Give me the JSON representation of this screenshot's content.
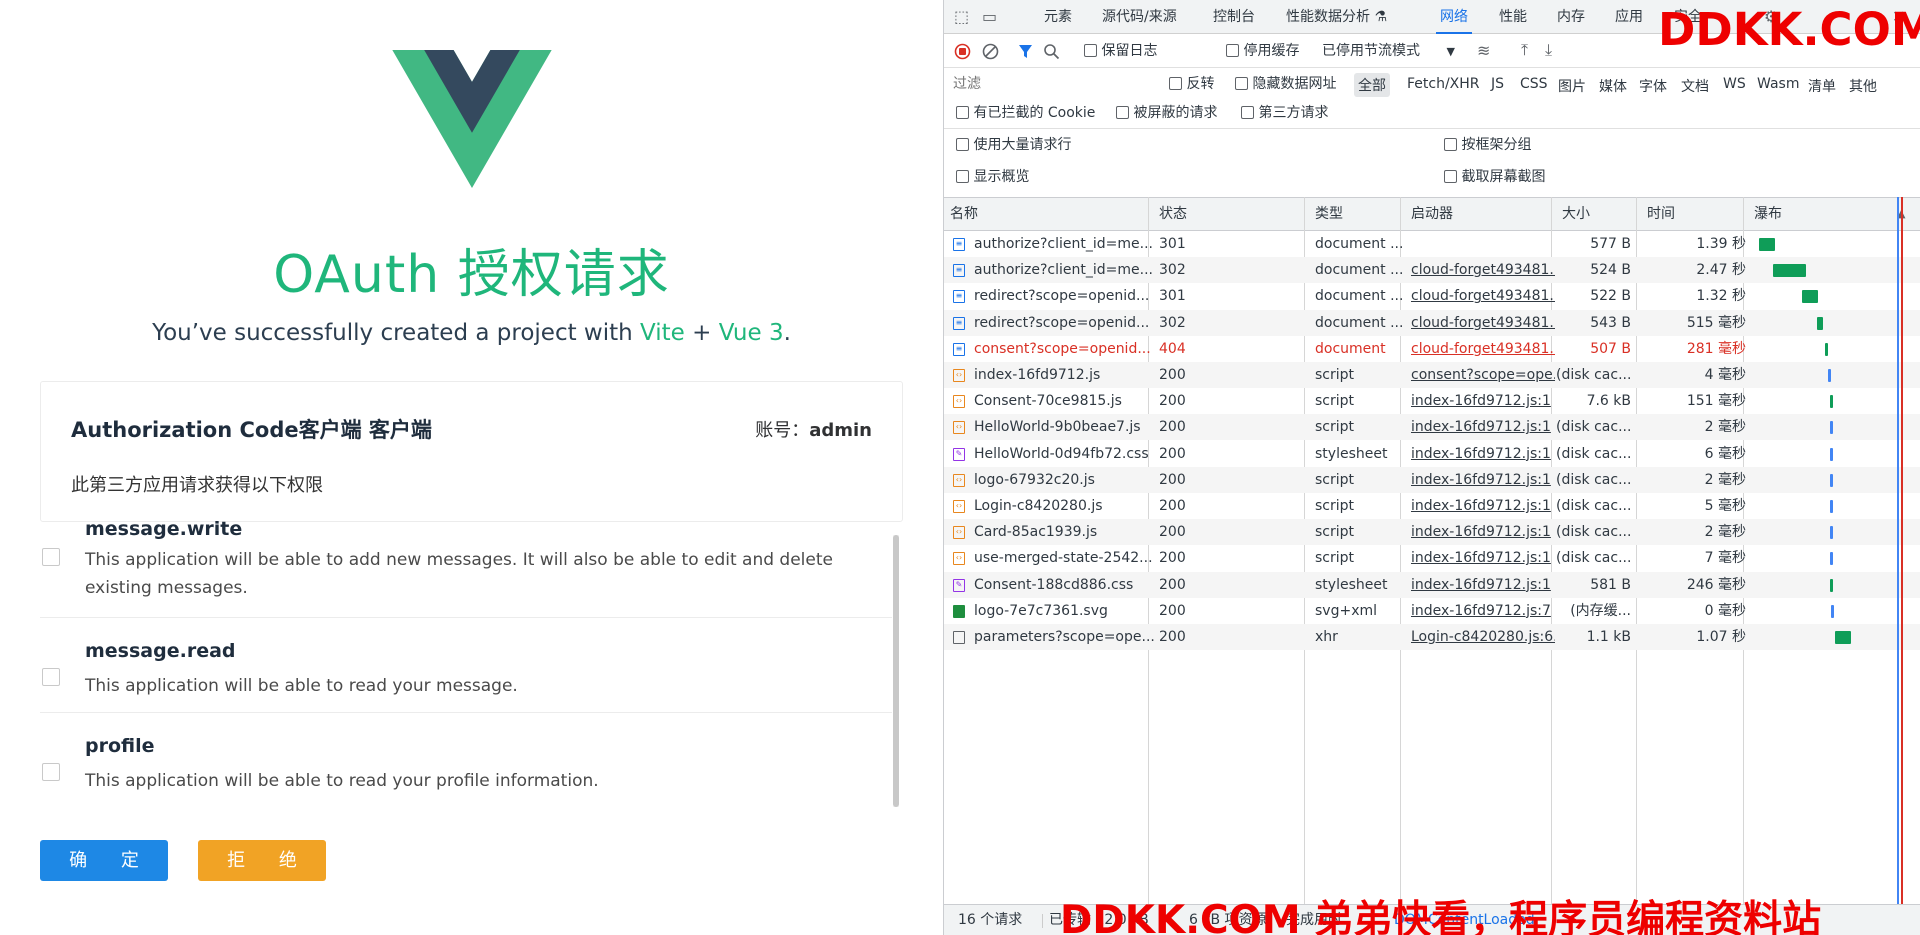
{
  "page": {
    "title": "OAuth 授权请求",
    "subtitle_prefix": "You’ve successfully created a project with ",
    "subtitle_vite": "Vite",
    "subtitle_plus": " + ",
    "subtitle_vue": "Vue 3",
    "subtitle_suffix": "."
  },
  "card": {
    "title": "Authorization Code客户端 客户端",
    "account_label": "账号：",
    "account_value": "admin",
    "description": "此第三方应用请求获得以下权限"
  },
  "scopes": [
    {
      "name": "message.write",
      "description": "This application will be able to add new messages. It will also be able to edit and delete existing messages.",
      "checked": false
    },
    {
      "name": "message.read",
      "description": "This application will be able to read your message.",
      "checked": false
    },
    {
      "name": "profile",
      "description": "This application will be able to read your profile information.",
      "checked": false
    }
  ],
  "buttons": {
    "confirm": "确 定",
    "reject": "拒 绝"
  },
  "colors": {
    "vue_green": "#41b883",
    "vue_dark": "#34495e",
    "title_green": "#1fb67b",
    "confirm_blue": "#1e88e5",
    "reject_orange": "#f1a325"
  },
  "devtools": {
    "tabs": [
      "元素",
      "源代码/来源",
      "控制台",
      "性能数据分析 ⚗",
      "网络",
      "性能",
      "内存",
      "应用",
      "安全"
    ],
    "active_tab": "网络",
    "toolbar": {
      "preserve_log": "保留日志",
      "disable_cache": "停用缓存",
      "throttling": "已停用节流模式"
    },
    "filter": {
      "placeholder": "过滤",
      "invert": "反转",
      "hide_data_urls": "隐藏数据网址",
      "types": [
        "全部",
        "Fetch/XHR",
        "JS",
        "CSS",
        "图片",
        "媒体",
        "字体",
        "文档",
        "WS",
        "Wasm",
        "清单",
        "其他"
      ],
      "blocked_cookies": "有已拦截的 Cookie",
      "blocked_requests": "被屏蔽的请求",
      "third_party": "第三方请求"
    },
    "options": {
      "big_rows": "使用大量请求行",
      "group_by_frame": "按框架分组",
      "overview": "显示概览",
      "screenshots": "截取屏幕截图"
    },
    "columns": [
      "名称",
      "状态",
      "类型",
      "启动器",
      "大小",
      "时间",
      "瀑布"
    ],
    "requests": [
      {
        "name": "authorize?client_id=me...",
        "status": "301",
        "type": "document ...",
        "initiator": "",
        "size": "577 B",
        "time": "1.39 秒",
        "icon": "document",
        "error": false,
        "wf": [
          0.03,
          0.1,
          "#0f9d58"
        ]
      },
      {
        "name": "authorize?client_id=me...",
        "status": "302",
        "type": "document ...",
        "initiator": "cloud-forget493481...",
        "size": "524 B",
        "time": "2.47 秒",
        "icon": "document",
        "error": false,
        "wf": [
          0.12,
          0.2,
          "#0f9d58"
        ]
      },
      {
        "name": "redirect?scope=openid...",
        "status": "301",
        "type": "document ...",
        "initiator": "cloud-forget493481...",
        "size": "522 B",
        "time": "1.32 秒",
        "icon": "document",
        "error": false,
        "wf": [
          0.3,
          0.1,
          "#0f9d58"
        ]
      },
      {
        "name": "redirect?scope=openid...",
        "status": "302",
        "type": "document ...",
        "initiator": "cloud-forget493481...",
        "size": "543 B",
        "time": "515 毫秒",
        "icon": "document",
        "error": false,
        "wf": [
          0.39,
          0.04,
          "#0f9d58"
        ]
      },
      {
        "name": "consent?scope=openid...",
        "status": "404",
        "type": "document",
        "initiator": "cloud-forget493481...",
        "size": "507 B",
        "time": "281 毫秒",
        "icon": "document",
        "error": true,
        "wf": [
          0.44,
          0.02,
          "#0f9d58"
        ]
      },
      {
        "name": "index-16fd9712.js",
        "status": "200",
        "type": "script",
        "initiator": "consent?scope=ope...",
        "size": "(disk cac...",
        "time": "4 毫秒",
        "icon": "script",
        "error": false,
        "wf": [
          0.46,
          0.01,
          "#4285f4"
        ]
      },
      {
        "name": "Consent-70ce9815.js",
        "status": "200",
        "type": "script",
        "initiator": "index-16fd9712.js:1",
        "size": "7.6 kB",
        "time": "151 毫秒",
        "icon": "script",
        "error": false,
        "wf": [
          0.47,
          0.02,
          "#0f9d58"
        ]
      },
      {
        "name": "HelloWorld-9b0beae7.js",
        "status": "200",
        "type": "script",
        "initiator": "index-16fd9712.js:1",
        "size": "(disk cac...",
        "time": "2 毫秒",
        "icon": "script",
        "error": false,
        "wf": [
          0.47,
          0.01,
          "#4285f4"
        ]
      },
      {
        "name": "HelloWorld-0d94fb72.css",
        "status": "200",
        "type": "stylesheet",
        "initiator": "index-16fd9712.js:1",
        "size": "(disk cac...",
        "time": "6 毫秒",
        "icon": "css",
        "error": false,
        "wf": [
          0.47,
          0.01,
          "#4285f4"
        ]
      },
      {
        "name": "logo-67932c20.js",
        "status": "200",
        "type": "script",
        "initiator": "index-16fd9712.js:1",
        "size": "(disk cac...",
        "time": "2 毫秒",
        "icon": "script",
        "error": false,
        "wf": [
          0.47,
          0.01,
          "#4285f4"
        ]
      },
      {
        "name": "Login-c8420280.js",
        "status": "200",
        "type": "script",
        "initiator": "index-16fd9712.js:1",
        "size": "(disk cac...",
        "time": "5 毫秒",
        "icon": "script",
        "error": false,
        "wf": [
          0.47,
          0.01,
          "#4285f4"
        ]
      },
      {
        "name": "Card-85ac1939.js",
        "status": "200",
        "type": "script",
        "initiator": "index-16fd9712.js:1",
        "size": "(disk cac...",
        "time": "2 毫秒",
        "icon": "script",
        "error": false,
        "wf": [
          0.47,
          0.01,
          "#4285f4"
        ]
      },
      {
        "name": "use-merged-state-2542...",
        "status": "200",
        "type": "script",
        "initiator": "index-16fd9712.js:1",
        "size": "(disk cac...",
        "time": "7 毫秒",
        "icon": "script",
        "error": false,
        "wf": [
          0.47,
          0.01,
          "#4285f4"
        ]
      },
      {
        "name": "Consent-188cd886.css",
        "status": "200",
        "type": "stylesheet",
        "initiator": "index-16fd9712.js:1",
        "size": "581 B",
        "time": "246 毫秒",
        "icon": "css",
        "error": false,
        "wf": [
          0.47,
          0.02,
          "#0f9d58"
        ]
      },
      {
        "name": "logo-7e7c7361.svg",
        "status": "200",
        "type": "svg+xml",
        "initiator": "index-16fd9712.js:7",
        "size": "(内存缓...",
        "time": "0 毫秒",
        "icon": "svg",
        "error": false,
        "wf": [
          0.48,
          0.01,
          "#4285f4"
        ]
      },
      {
        "name": "parameters?scope=ope...",
        "status": "200",
        "type": "xhr",
        "initiator": "Login-c8420280.js:6...",
        "size": "1.1 kB",
        "time": "1.07 秒",
        "icon": "xhr",
        "error": false,
        "wf": [
          0.5,
          0.1,
          "#0f9d58"
        ]
      }
    ],
    "status_bar": {
      "requests": "16 个请求",
      "transferred": "已传输 12.0 kB",
      "resources": "6 kB 项资源",
      "finish": "完成用时",
      "dom_loaded": "DOMContentLoaded"
    }
  },
  "watermarks": {
    "top": "DDKK.COM",
    "bottom": "DDKK.COM 弟弟快看，程序员编程资料站"
  }
}
